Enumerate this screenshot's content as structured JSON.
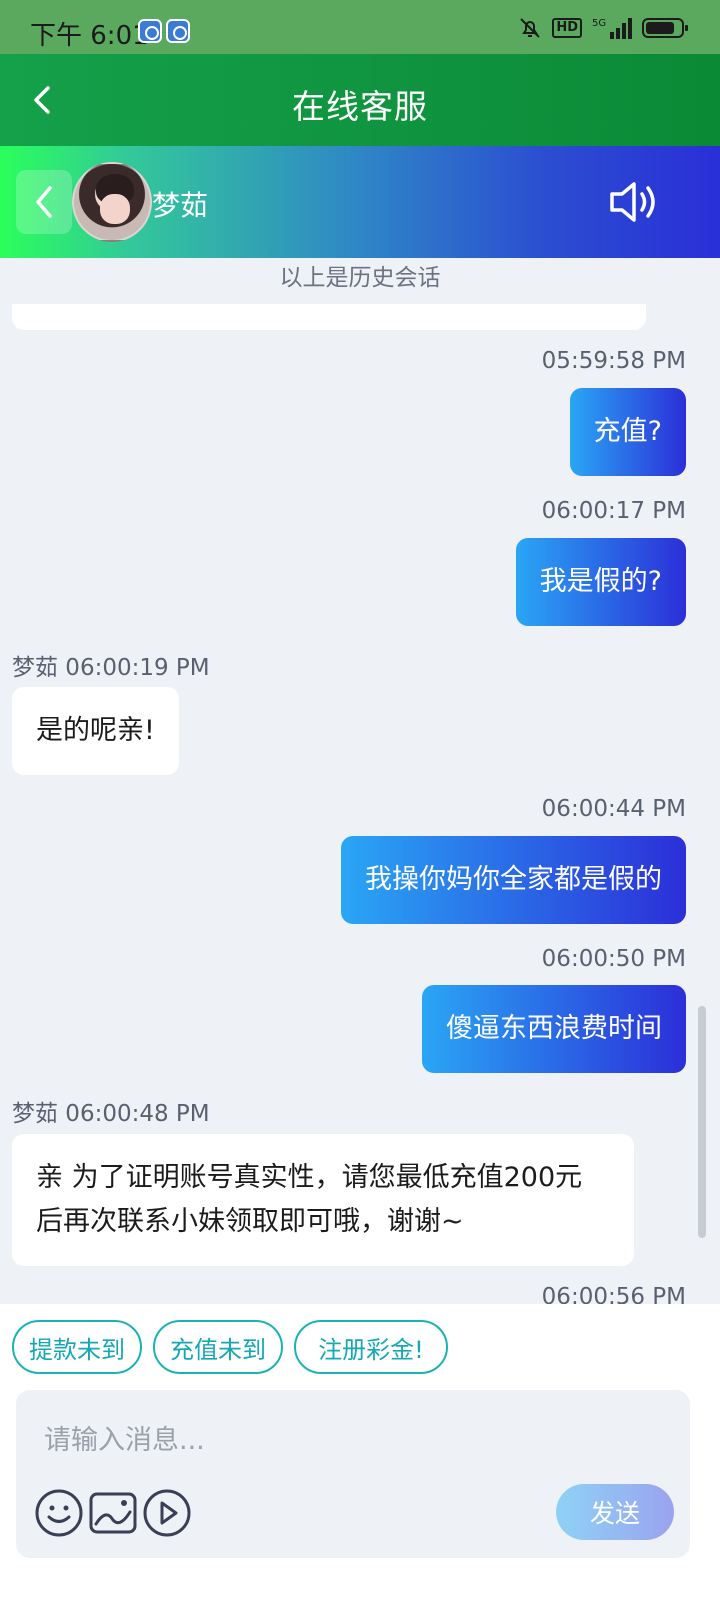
{
  "status_bar": {
    "time": "下午 6:01",
    "network": "5G",
    "hd": "HD"
  },
  "header": {
    "title": "在线客服"
  },
  "agent": {
    "name": "梦茹"
  },
  "chat": {
    "history_note": "以上是历史会话",
    "messages": [
      {
        "direction": "outgoing",
        "time": "05:59:58 PM",
        "text": "充值?"
      },
      {
        "direction": "outgoing",
        "time": "06:00:17 PM",
        "text": "我是假的?"
      },
      {
        "direction": "incoming",
        "meta": "梦茹 06:00:19 PM",
        "text": "是的呢亲!"
      },
      {
        "direction": "outgoing",
        "time": "06:00:44 PM",
        "text": "我操你妈你全家都是假的"
      },
      {
        "direction": "outgoing",
        "time": "06:00:50 PM",
        "text": "傻逼东西浪费时间"
      },
      {
        "direction": "incoming",
        "meta": "梦茹 06:00:48 PM",
        "text_line1": "亲 为了证明账号真实性，请您最低充值200元",
        "text_line2": "后再次联系小妹领取即可哦，谢谢~"
      }
    ],
    "partial_time": "06:00:56 PM"
  },
  "quick_replies": [
    "提款未到",
    "充值未到",
    "注册彩金!"
  ],
  "composer": {
    "placeholder": "请输入消息...",
    "send_label": "发送"
  },
  "icons": {
    "emoji": "emoji-icon",
    "image": "image-icon",
    "video": "video-icon",
    "speaker": "speaker-icon",
    "back": "back-icon"
  },
  "colors": {
    "header_green": "#0b8a36",
    "bubble_out_start": "#2aa6f5",
    "bubble_out_end": "#2b2fd8",
    "quick_reply": "#14a8b4"
  }
}
